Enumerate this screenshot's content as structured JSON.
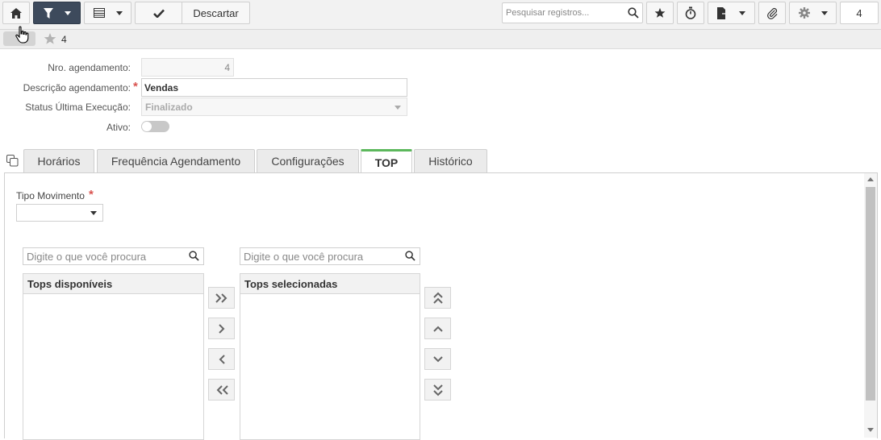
{
  "toolbar": {
    "discard_label": "Descartar",
    "search_placeholder": "Pesquisar registros...",
    "record_count": "4"
  },
  "breadcrumb": {
    "record_id": "4"
  },
  "form": {
    "nro_label": "Nro. agendamento:",
    "nro_value": "4",
    "descricao_label": "Descrição agendamento:",
    "descricao_value": "Vendas",
    "status_label": "Status Última Execução:",
    "status_value": "Finalizado",
    "ativo_label": "Ativo:",
    "ativo_value": false,
    "required_mark": "*"
  },
  "tabs": [
    {
      "label": "Horários",
      "active": false
    },
    {
      "label": "Frequência Agendamento",
      "active": false
    },
    {
      "label": "Configurações",
      "active": false
    },
    {
      "label": "TOP",
      "active": true
    },
    {
      "label": "Histórico",
      "active": false
    }
  ],
  "top_tab": {
    "tipo_movimento_label": "Tipo Movimento",
    "tipo_movimento_value": "",
    "left_search_placeholder": "Digite o que você procura",
    "right_search_placeholder": "Digite o que você procura",
    "available_header": "Tops disponíveis",
    "selected_header": "Tops selecionadas"
  },
  "colors": {
    "active_tab_accent": "#5cb85c",
    "required": "#d9534f",
    "dark_button": "#3d4a5c"
  }
}
